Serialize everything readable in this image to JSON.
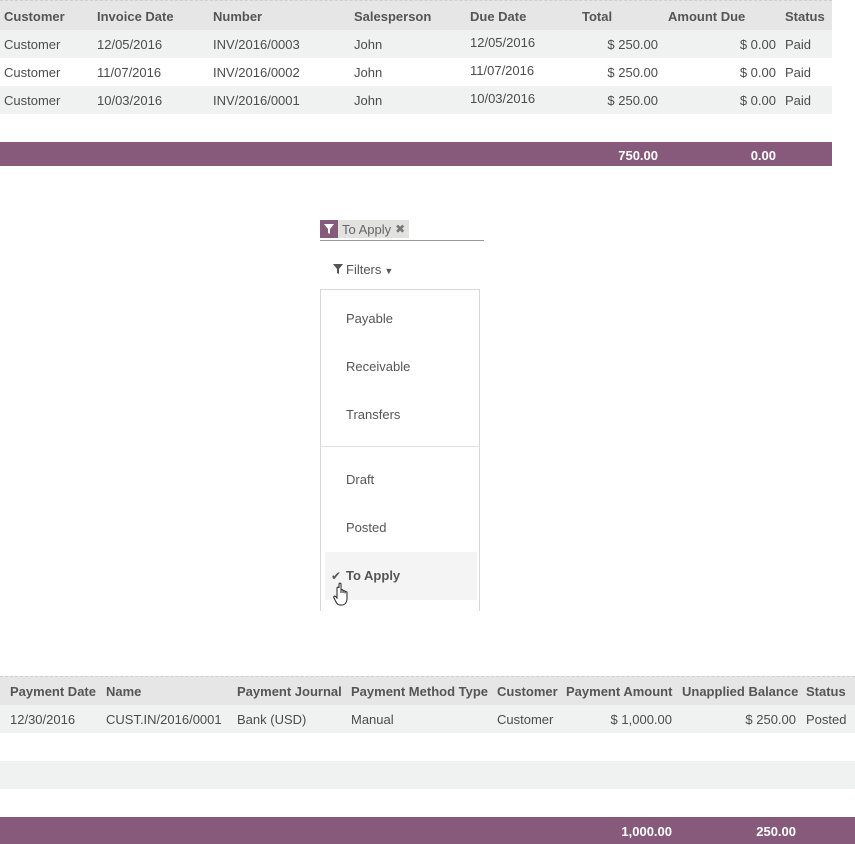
{
  "invoices": {
    "columns": [
      "Customer",
      "Invoice Date",
      "Number",
      "Salesperson",
      "Due Date",
      "Total",
      "Amount Due",
      "Status"
    ],
    "rows": [
      [
        "Customer",
        "12/05/2016",
        "INV/2016/0003",
        "John",
        "12/05/2016",
        "$ 250.00",
        "$ 0.00",
        "Paid"
      ],
      [
        "Customer",
        "11/07/2016",
        "INV/2016/0002",
        "John",
        "11/07/2016",
        "$ 250.00",
        "$ 0.00",
        "Paid"
      ],
      [
        "Customer",
        "10/03/2016",
        "INV/2016/0001",
        "John",
        "10/03/2016",
        "$ 250.00",
        "$ 0.00",
        "Paid"
      ]
    ],
    "totals": {
      "total": "750.00",
      "amount_due": "0.00"
    }
  },
  "search": {
    "facet_value": "To Apply",
    "facet_icon": "filter-icon",
    "remove_icon": "close-icon"
  },
  "filters": {
    "button_label": "Filters",
    "items": [
      "Payable",
      "Receivable",
      "Transfers",
      "Draft",
      "Posted",
      "To Apply"
    ],
    "active_item": "To Apply"
  },
  "payments": {
    "columns": [
      "Payment Date",
      "Name",
      "Payment Journal",
      "Payment Method Type",
      "Customer",
      "Payment Amount",
      "Unapplied Balance",
      "Status"
    ],
    "rows": [
      [
        "12/30/2016",
        "CUST.IN/2016/0001",
        "Bank (USD)",
        "Manual",
        "Customer",
        "$ 1,000.00",
        "$ 250.00",
        "Posted"
      ]
    ],
    "totals": {
      "payment_amount": "1,000.00",
      "unapplied_balance": "250.00"
    }
  },
  "colors": {
    "accent": "#875a7b",
    "header_bg": "#e6e6e6",
    "row_alt": "#f0f1f1"
  }
}
